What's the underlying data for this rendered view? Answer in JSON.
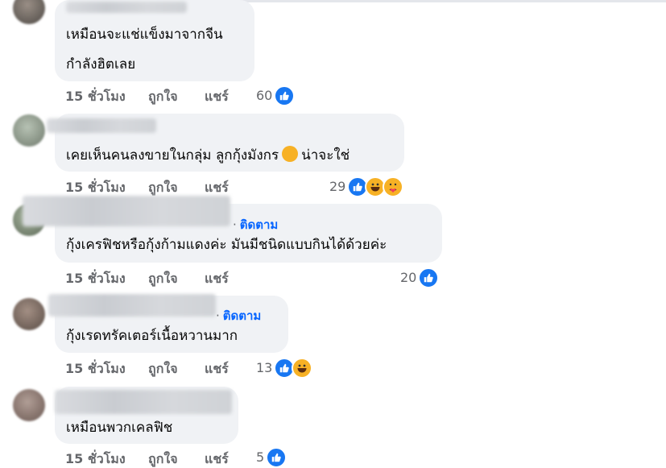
{
  "comments": [
    {
      "lines": [
        "เหมือนจะแช่แข็งมาจากจีน",
        "กำลังฮิตเลย"
      ],
      "follow": null,
      "time": "15 ชั่วโมง",
      "like_label": "ถูกใจ",
      "share_label": "แชร์",
      "reaction_count": "60",
      "reactions": [
        "like-icon"
      ]
    },
    {
      "lines": [
        "เคยเห็นคนลงขายในกลุ่ม ลูกกุ้งมังกร",
        "น่าจะใช่"
      ],
      "follow": null,
      "time": "15 ชั่วโมง",
      "like_label": "ถูกใจ",
      "share_label": "แชร์",
      "reaction_count": "29",
      "reactions": [
        "like-icon",
        "haha-icon",
        "care-icon"
      ]
    },
    {
      "lines": [
        "กุ้งเครฟิชหรือกุ้งก้ามแดงค่ะ มันมีชนิดแบบกินได้ด้วยค่ะ"
      ],
      "follow": "ติดตาม",
      "time": "15 ชั่วโมง",
      "like_label": "ถูกใจ",
      "share_label": "แชร์",
      "reaction_count": "20",
      "reactions": [
        "like-icon"
      ]
    },
    {
      "lines": [
        "กุ้งเรดทรัคเตอร์เนื้อหวานมาก"
      ],
      "follow": "ติดตาม",
      "time": "15 ชั่วโมง",
      "like_label": "ถูกใจ",
      "share_label": "แชร์",
      "reaction_count": "13",
      "reactions": [
        "like-icon",
        "haha-icon"
      ]
    },
    {
      "lines": [
        "เหมือนพวกเคลฟิช"
      ],
      "follow": null,
      "time": "15 ชั่วโมง",
      "like_label": "ถูกใจ",
      "share_label": "แชร์",
      "reaction_count": "5",
      "reactions": [
        "like-icon"
      ]
    }
  ],
  "colors": {
    "bubble": "#f0f2f5",
    "action_text": "#65676b",
    "follow_link": "#0866ff",
    "like": "#1877f2",
    "haha": "#f7b125"
  }
}
